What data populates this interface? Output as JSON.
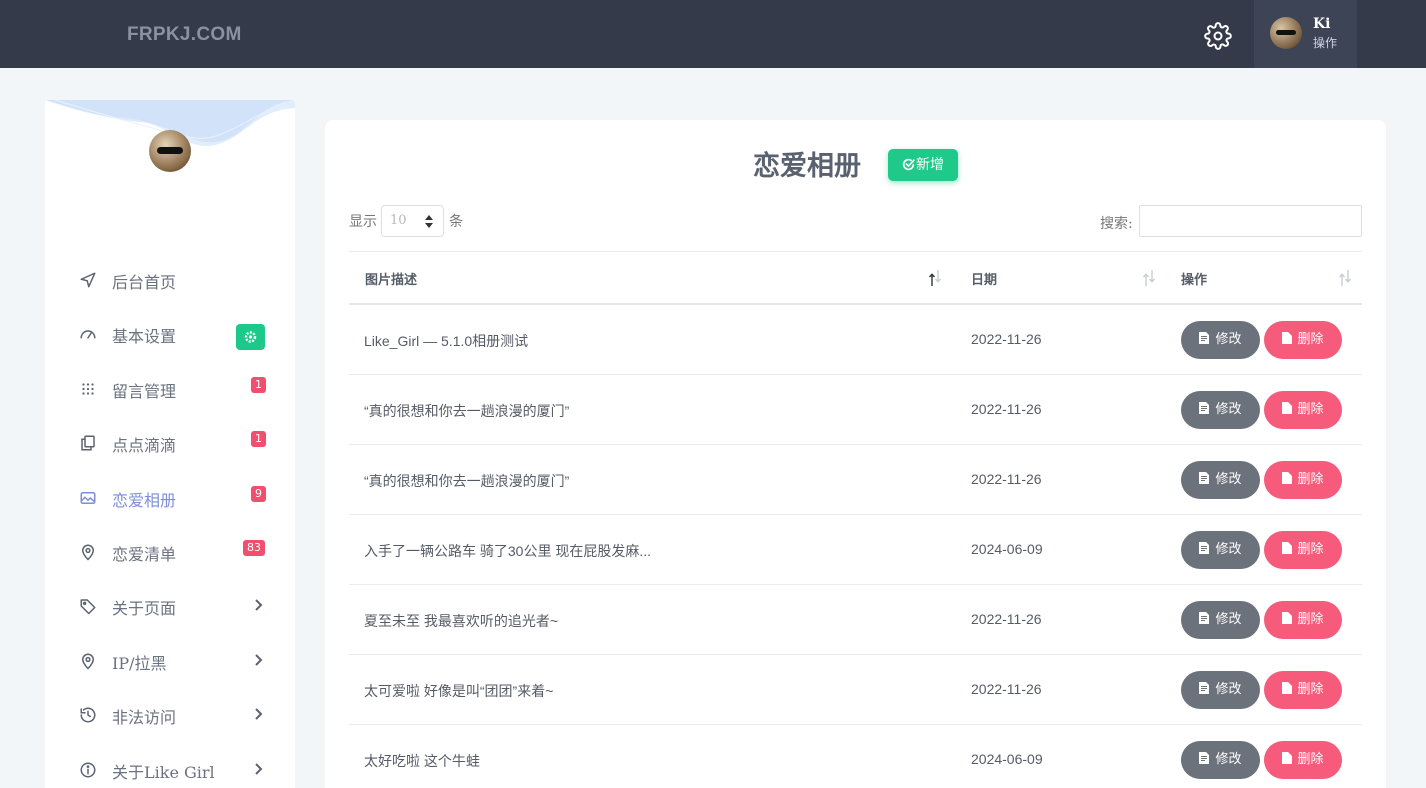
{
  "header": {
    "brand": "FRPKJ.COM",
    "user_name": "Ki",
    "user_role": "操作"
  },
  "sidebar": {
    "items": [
      {
        "label": "后台首页",
        "icon": "send-icon"
      },
      {
        "label": "基本设置",
        "icon": "gauge-icon",
        "badge_icon": "gear-icon"
      },
      {
        "label": "留言管理",
        "icon": "grid-icon",
        "badge": "1"
      },
      {
        "label": "点点滴滴",
        "icon": "copy-icon",
        "badge": "1"
      },
      {
        "label": "恋爱相册",
        "icon": "image-icon",
        "badge": "9",
        "active": true
      },
      {
        "label": "恋爱清单",
        "icon": "map-pin-icon",
        "badge": "83"
      },
      {
        "label": "关于页面",
        "icon": "tag-icon",
        "has_submenu": true
      },
      {
        "label": "IP/拉黑",
        "icon": "map-pin-icon",
        "has_submenu": true
      },
      {
        "label": "非法访问",
        "icon": "history-icon",
        "has_submenu": true
      },
      {
        "label": "关于Like Girl",
        "icon": "info-icon",
        "has_submenu": true
      }
    ]
  },
  "main": {
    "title": "恋爱相册",
    "add_label": "新增",
    "show_label": "显示",
    "per_page": "10",
    "unit_label": "条",
    "search_label": "搜索:",
    "search_value": "",
    "columns": [
      "图片描述",
      "日期",
      "操作"
    ],
    "edit_label": "修改",
    "delete_label": "删除",
    "rows": [
      {
        "desc": "Like_Girl — 5.1.0相册测试",
        "date": "2022-11-26"
      },
      {
        "desc": "“真的很想和你去一趟浪漫的厦门”",
        "date": "2022-11-26"
      },
      {
        "desc": "“真的很想和你去一趟浪漫的厦门”",
        "date": "2022-11-26"
      },
      {
        "desc": "入手了一辆公路车 骑了30公里 现在屁股发麻...",
        "date": "2024-06-09"
      },
      {
        "desc": "夏至未至 我最喜欢听的追光者~",
        "date": "2022-11-26"
      },
      {
        "desc": "太可爱啦 好像是叫“团团”来着~",
        "date": "2022-11-26"
      },
      {
        "desc": "太好吃啦 这个牛蛙",
        "date": "2024-06-09"
      }
    ]
  },
  "colors": {
    "topbar": "#343a4a",
    "accent_green": "#1ec98a",
    "delete_pink": "#f65b7b",
    "edit_gray": "#6c727c",
    "active_menu": "#7e8ed8"
  }
}
